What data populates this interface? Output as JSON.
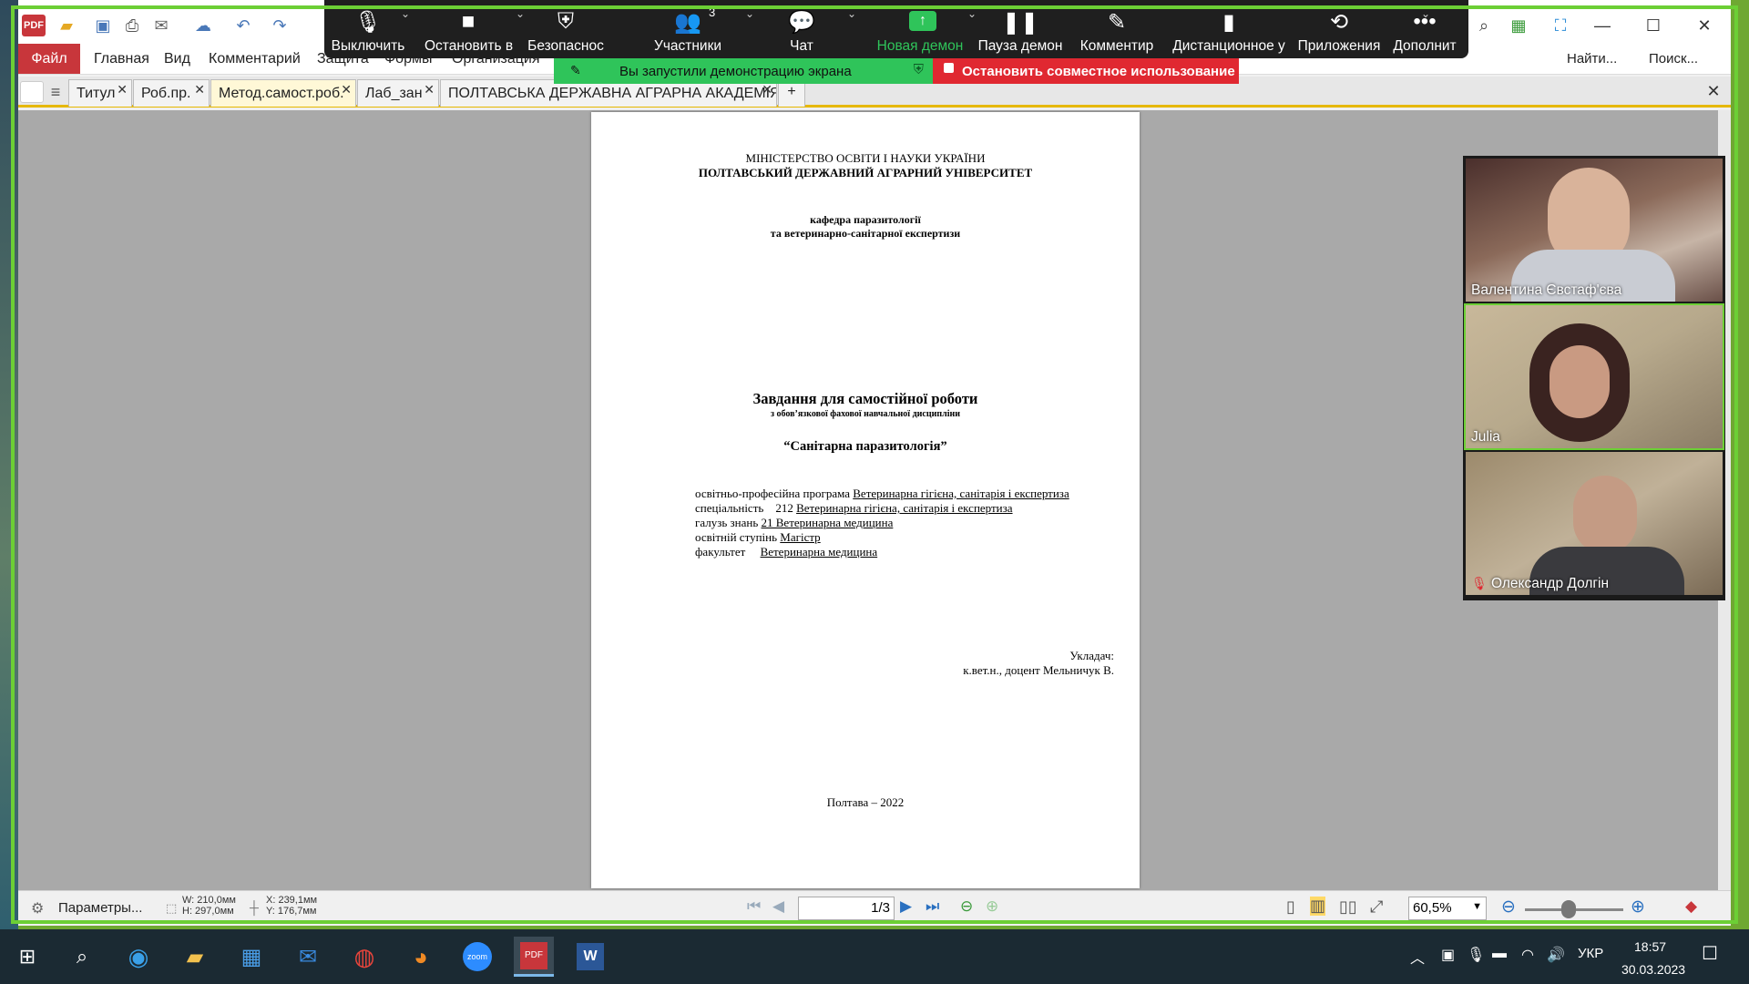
{
  "zoom_toolbar": {
    "mute_label": "Выключить",
    "video_label": "Остановить в",
    "security_label": "Безопаснос",
    "participants_label": "Участники",
    "participants_count": "3",
    "chat_label": "Чат",
    "new_share_label": "Новая демон",
    "pause_share_label": "Пауза демон",
    "annotate_label": "Комментир",
    "remote_label": "Дистанционное у",
    "apps_label": "Приложения",
    "more_label": "Дополнит",
    "share_banner": "Вы запустили демонстрацию экрана",
    "stop_share": "Остановить совместное использование"
  },
  "menu": {
    "file": "Файл",
    "items": [
      "Главная",
      "Вид",
      "Комментарий",
      "Защита",
      "Формы",
      "Организация"
    ],
    "find": "Найти...",
    "search": "Поиск..."
  },
  "tabs": [
    {
      "label": "Титул"
    },
    {
      "label": "Роб.пр."
    },
    {
      "label": "Метод.самост.роб."
    },
    {
      "label": "Лаб_зан"
    },
    {
      "label": "ПОЛТАВСЬКА ДЕРЖАВНА АГРАРНА АКАДЕМІЯ"
    }
  ],
  "document": {
    "ministry": "МІНІСТЕРСТВО ОСВІТИ І НАУКИ УКРАЇНИ",
    "university": "ПОЛТАВСЬКИЙ ДЕРЖАВНИЙ АГРАРНИЙ УНІВЕРСИТЕТ",
    "department_1": "кафедра паразитології",
    "department_2": "та ветеринарно-санітарної експертизи",
    "title": "Завдання для самостійної роботи",
    "subtitle": "з обов’язкової фахової навчальної дисципліни",
    "discipline": "“Санітарна паразитологія”",
    "program_label": "освітньо-професійна програма",
    "program_value": "Ветеринарна гігієна, санітарія і експертиза",
    "specialty_label": "спеціальність",
    "specialty_code": "212",
    "specialty_value": "Ветеринарна гігієна, санітарія і експертиза",
    "field_label": "галузь знань",
    "field_value": "21 Ветеринарна медицина",
    "degree_label": "освітній ступінь",
    "degree_value": "Магістр",
    "faculty_label": "факультет",
    "faculty_value": "Ветеринарна медицина",
    "author_label": "Укладач:",
    "author_name": "к.вет.н., доцент Мельничук В.",
    "footer": "Полтава – 2022"
  },
  "statusbar": {
    "settings": "Параметры...",
    "width": "W: 210,0мм",
    "height": "H: 297,0мм",
    "x": "X: 239,1мм",
    "y": "Y: 176,7мм",
    "page_current": "1",
    "page_total": "/3",
    "zoom": "60,5%"
  },
  "participants": [
    {
      "name": "Валентина Євстаф'єва"
    },
    {
      "name": "Julia"
    },
    {
      "name": "Олександр Долгін"
    }
  ],
  "taskbar": {
    "language": "УКР",
    "time": "18:57",
    "date": "30.03.2023"
  },
  "colors": {
    "share_border": "#6ccf35",
    "share_banner": "#2fc45a",
    "stop_share": "#e02831",
    "file_menu": "#c8363b",
    "zoom_toolbar": "#1f1f1f"
  }
}
